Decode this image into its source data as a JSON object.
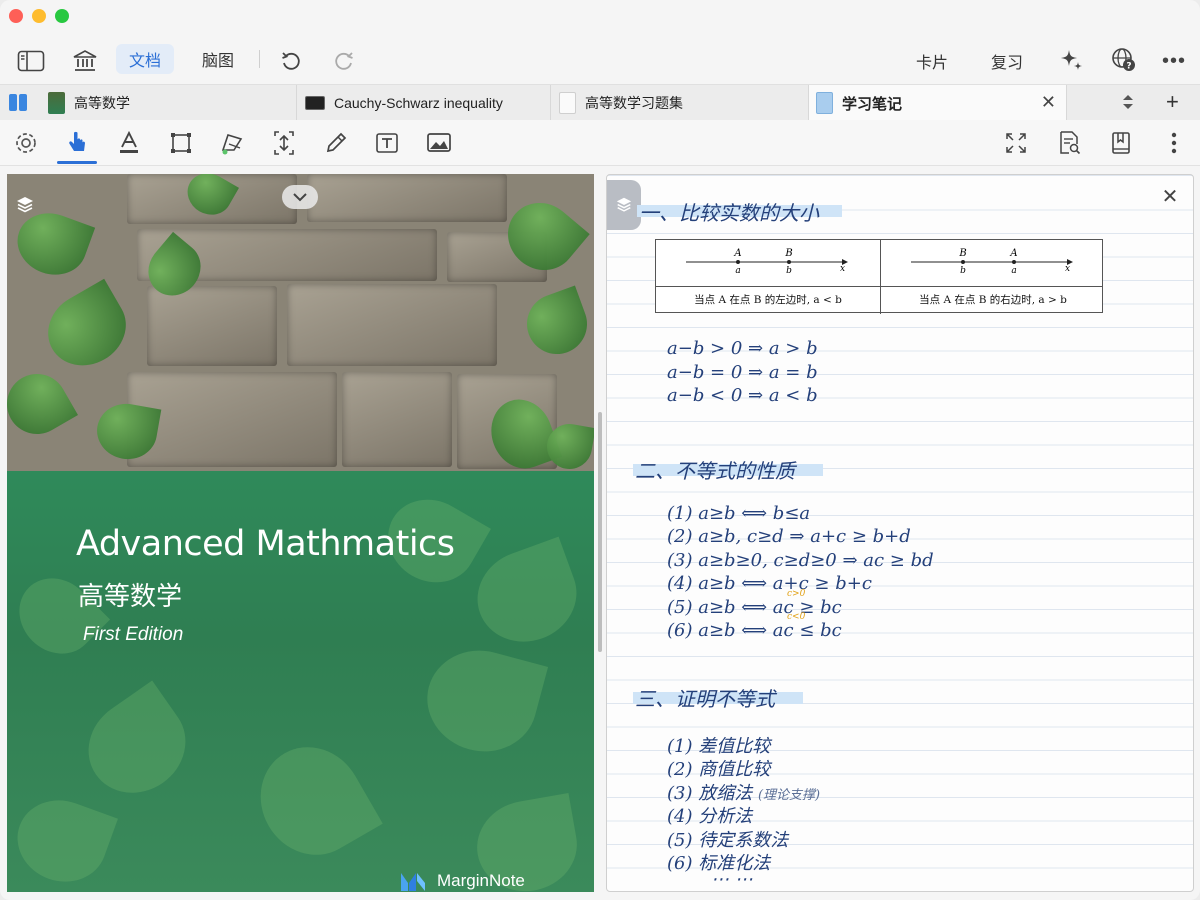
{
  "toolbar": {
    "doc_label": "文档",
    "mindmap_label": "脑图",
    "card_label": "卡片",
    "review_label": "复习"
  },
  "tabs": [
    {
      "label": "高等数学"
    },
    {
      "label": "Cauchy-Schwarz inequality"
    },
    {
      "label": "高等数学习题集"
    },
    {
      "label": "学习笔记"
    }
  ],
  "cover": {
    "title": "Advanced Mathmatics",
    "subtitle": "高等数学",
    "edition": "First Edition",
    "brand": "MarginNote"
  },
  "notes": {
    "section1": "一、比较实数的大小",
    "table": {
      "left": {
        "p1": "A",
        "p2": "B",
        "v1": "a",
        "v2": "b",
        "axis": "x",
        "caption": "当点 A 在点 B 的左边时, a < b"
      },
      "right": {
        "p1": "B",
        "p2": "A",
        "v1": "b",
        "v2": "a",
        "axis": "x",
        "caption": "当点 A 在点 B 的右边时, a > b"
      }
    },
    "compare": [
      "a−b > 0  ⇒  a > b",
      "a−b = 0  ⇒  a = b",
      "a−b < 0  ⇒  a < b"
    ],
    "section2": "二、不等式的性质",
    "properties": [
      "(1) a≥b  ⟺  b≤a",
      "(2) a≥b, c≥d ⇒  a+c ≥ b+d",
      "(3) a≥b≥0, c≥d≥0 ⇒  ac ≥ bd",
      "(4) a≥b  ⟺  a+c ≥ b+c",
      "(5) a≥b  ⟺  ac ≥ bc",
      "(6) a≥b  ⟺  ac ≤ bc"
    ],
    "cond5": "c>0",
    "cond6": "c<0",
    "section3": "三、证明不等式",
    "methods": [
      "(1) 差值比较",
      "(2) 商值比较",
      "(3) 放缩法",
      "(4) 分析法",
      "(5) 待定系数法",
      "(6) 标准化法"
    ],
    "method3_note": "(理论支撑)",
    "ellipsis": "⋯  ⋯"
  },
  "colors": {
    "accent": "#2b6fd6",
    "ink": "#24407a",
    "highlight": "#cfe4f7",
    "cover_green": "#2f7e52"
  }
}
